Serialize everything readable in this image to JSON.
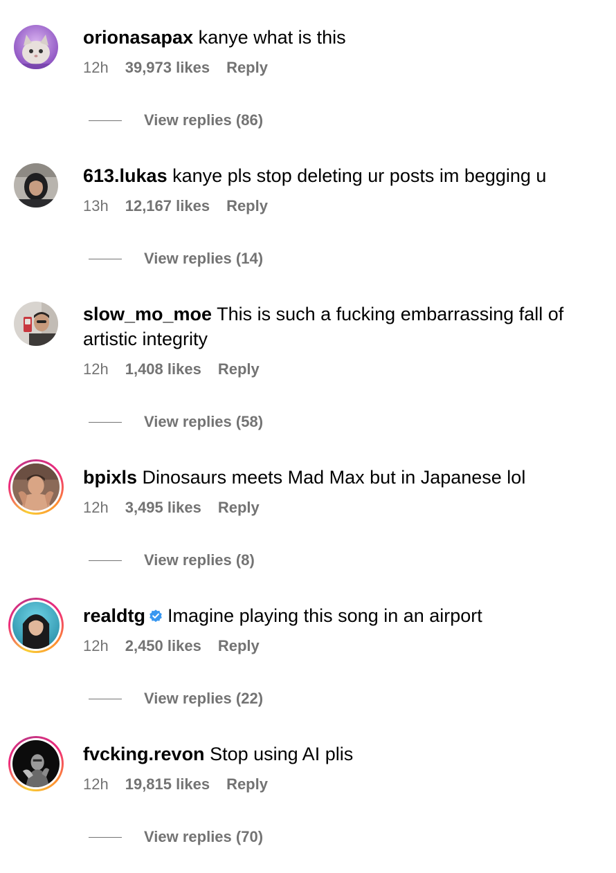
{
  "comments": [
    {
      "username": "orionasapax",
      "text": "kanye what is this",
      "time": "12h",
      "likes": "39,973 likes",
      "reply_label": "Reply",
      "view_replies": "View replies (86)",
      "avatar_icon": "cat-avatar",
      "story_ring": false,
      "verified": false
    },
    {
      "username": "613.lukas",
      "text": "kanye pls stop deleting ur posts im begging u",
      "time": "13h",
      "likes": "12,167 likes",
      "reply_label": "Reply",
      "view_replies": "View replies (14)",
      "avatar_icon": "hooded-person-avatar",
      "story_ring": false,
      "verified": false
    },
    {
      "username": "slow_mo_moe",
      "text": "This is such a fucking embarrassing fall of artistic integrity",
      "time": "12h",
      "likes": "1,408 likes",
      "reply_label": "Reply",
      "view_replies": "View replies (58)",
      "avatar_icon": "mirror-selfie-avatar",
      "story_ring": false,
      "verified": false
    },
    {
      "username": "bpixls",
      "text": "Dinosaurs meets Mad Max but in Japanese lol",
      "time": "12h",
      "likes": "3,495 likes",
      "reply_label": "Reply",
      "view_replies": "View replies (8)",
      "avatar_icon": "man-portrait-avatar",
      "story_ring": true,
      "verified": false
    },
    {
      "username": "realdtg",
      "text": "Imagine playing this song in an airport",
      "time": "12h",
      "likes": "2,450 likes",
      "reply_label": "Reply",
      "view_replies": "View replies (22)",
      "avatar_icon": "hooded-man-avatar",
      "story_ring": true,
      "verified": true
    },
    {
      "username": "fvcking.revon",
      "text": "Stop using AI plis",
      "time": "12h",
      "likes": "19,815 likes",
      "reply_label": "Reply",
      "view_replies": "View replies (70)",
      "avatar_icon": "dark-figure-avatar",
      "story_ring": true,
      "verified": false
    }
  ],
  "colors": {
    "secondary_text": "#737373",
    "verified_blue": "#3897f0",
    "ring_gradient": [
      "#f9ce34",
      "#ee2a7b",
      "#c13584"
    ]
  }
}
